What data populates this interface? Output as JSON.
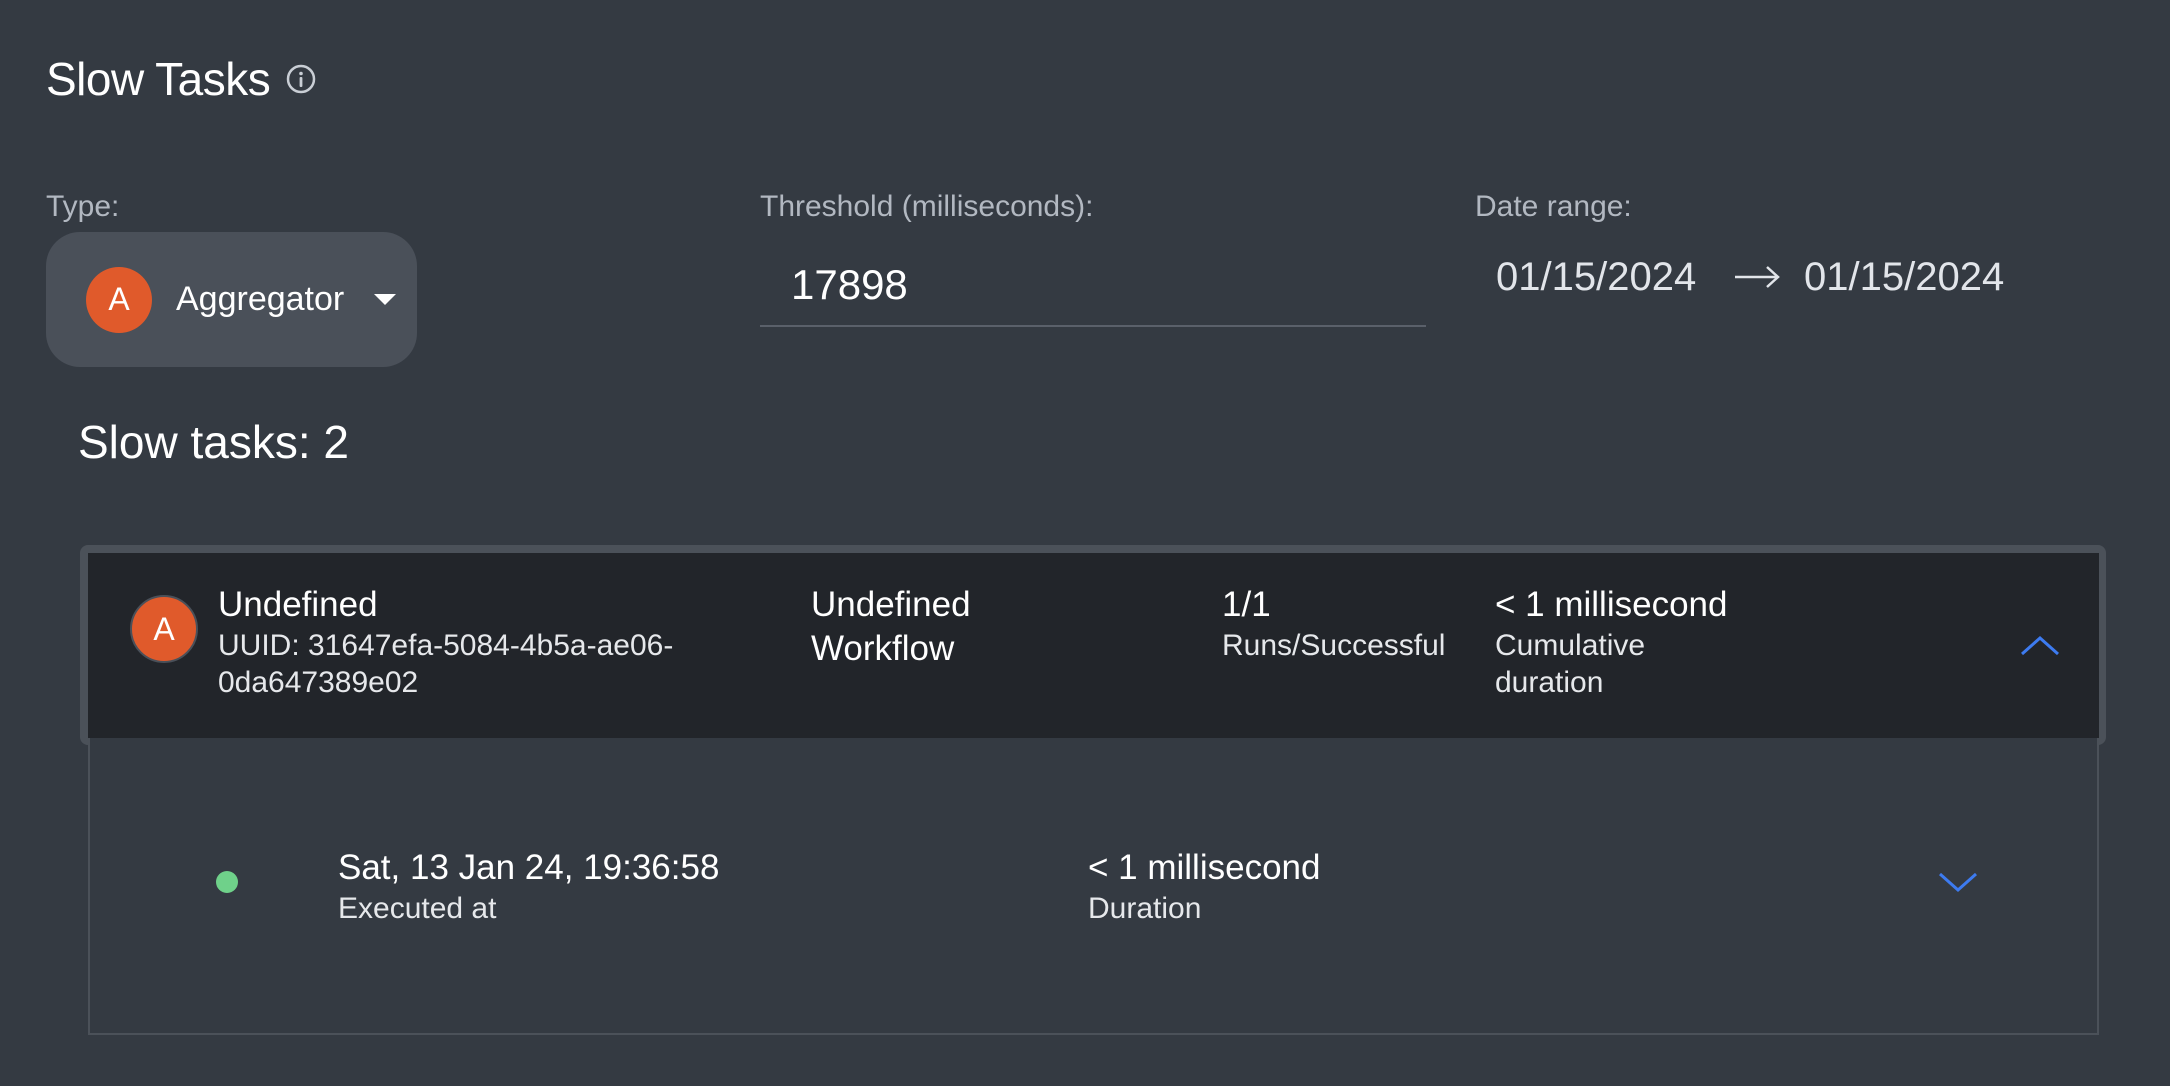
{
  "page": {
    "title": "Slow Tasks"
  },
  "filters": {
    "type_label": "Type:",
    "type_value": "Aggregator",
    "type_avatar": "A",
    "threshold_label": "Threshold (milliseconds):",
    "threshold_value": "17898",
    "date_label": "Date range:",
    "date_start": "01/15/2024",
    "date_end": "01/15/2024"
  },
  "summary": {
    "count_text": "Slow tasks: 2"
  },
  "tasks": [
    {
      "avatar": "A",
      "name": "Undefined",
      "uuid": "UUID: 31647efa-5084-4b5a-ae06-0da647389e02",
      "workflow_line1": "Undefined",
      "workflow_line2": "Workflow",
      "runs": "1/1",
      "runs_label": "Runs/Successful",
      "cumulative": "< 1 millisecond",
      "cumulative_label": "Cumulative duration",
      "expanded": true,
      "runs_list": [
        {
          "status": "success",
          "executed_at": "Sat, 13 Jan 24, 19:36:58",
          "executed_label": "Executed at",
          "duration": "< 1 millisecond",
          "duration_label": "Duration"
        }
      ]
    }
  ],
  "colors": {
    "background": "#343a42",
    "card_header": "#22252a",
    "avatar": "#e05a2b",
    "accent": "#3d7bf0",
    "success": "#6fd18a"
  },
  "icons": {
    "info": "info-icon",
    "caret": "caret-down-icon",
    "arrow": "arrow-right-icon",
    "collapse": "chevron-up-icon",
    "expand": "chevron-down-icon"
  }
}
